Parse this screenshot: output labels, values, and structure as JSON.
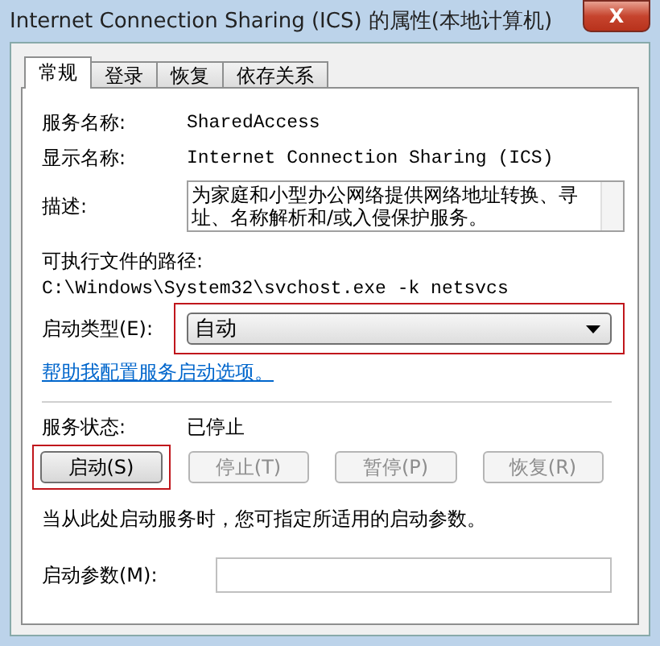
{
  "window": {
    "title": "Internet Connection Sharing (ICS) 的属性(本地计算机)",
    "close": "X"
  },
  "tabs": [
    {
      "label": "常规",
      "selected": true
    },
    {
      "label": "登录",
      "selected": false
    },
    {
      "label": "恢复",
      "selected": false
    },
    {
      "label": "依存关系",
      "selected": false
    }
  ],
  "service_name": {
    "label": "服务名称:",
    "value": "SharedAccess"
  },
  "display_name": {
    "label": "显示名称:",
    "value": "Internet Connection Sharing (ICS)"
  },
  "description": {
    "label": "描述:",
    "value": "为家庭和小型办公网络提供网络地址转换、寻址、名称解析和/或入侵保护服务。"
  },
  "executable_path": {
    "label": "可执行文件的路径:",
    "value": "C:\\Windows\\System32\\svchost.exe -k netsvcs"
  },
  "startup_type": {
    "label": "启动类型(E):",
    "value": "自动",
    "highlighted": true
  },
  "help_link": "帮助我配置服务启动选项。",
  "service_status": {
    "label": "服务状态:",
    "value": "已停止"
  },
  "buttons": [
    {
      "label": "启动(S)",
      "disabled": false,
      "highlighted": true
    },
    {
      "label": "停止(T)",
      "disabled": true,
      "highlighted": false
    },
    {
      "label": "暂停(P)",
      "disabled": true,
      "highlighted": false
    },
    {
      "label": "恢复(R)",
      "disabled": true,
      "highlighted": false
    }
  ],
  "note": "当从此处启动服务时，您可指定所适用的启动参数。",
  "start_parameters": {
    "label": "启动参数(M):"
  }
}
